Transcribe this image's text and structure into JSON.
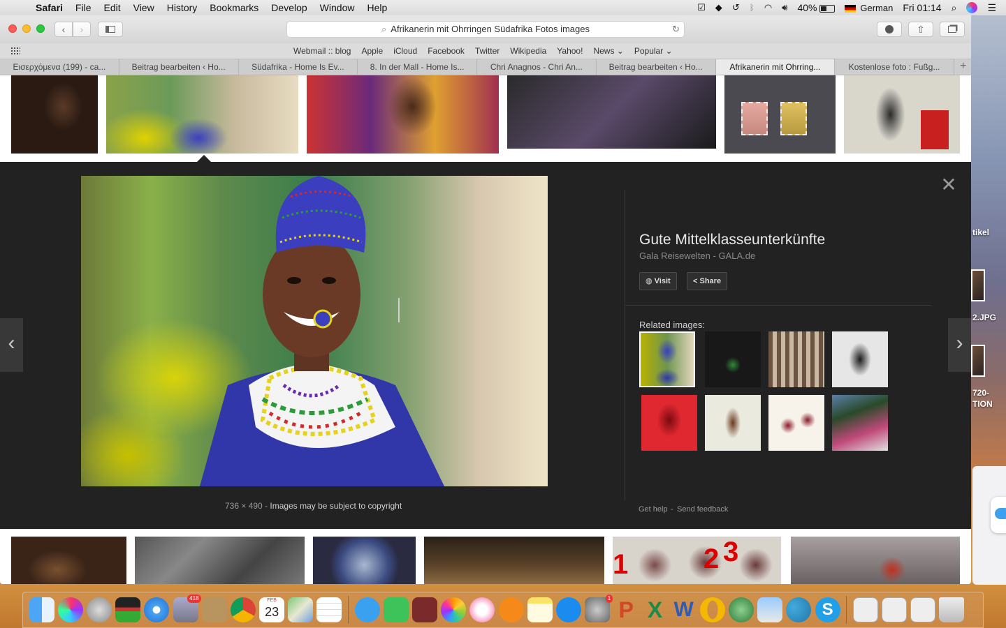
{
  "menubar": {
    "app": "Safari",
    "items": [
      "File",
      "Edit",
      "View",
      "History",
      "Bookmarks",
      "Develop",
      "Window",
      "Help"
    ],
    "battery": "40%",
    "language": "German",
    "clock": "Fri 01:14"
  },
  "toolbar": {
    "url": "Afrikanerin mit Ohrringen Südafrika Fotos images"
  },
  "favorites": [
    "Webmail :: blog",
    "Apple",
    "iCloud",
    "Facebook",
    "Twitter",
    "Wikipedia",
    "Yahoo!",
    "News ⌄",
    "Popular ⌄"
  ],
  "tabs": [
    {
      "label": "Εισερχόμενα (199) - ca..."
    },
    {
      "label": "Beitrag bearbeiten ‹ Ho..."
    },
    {
      "label": "Südafrika - Home Is Ev..."
    },
    {
      "label": "8. In der Mall - Home Is..."
    },
    {
      "label": "Chri Anagnos - Chri An..."
    },
    {
      "label": "Beitrag bearbeiten ‹ Ho..."
    },
    {
      "label": "Afrikanerin mit Ohrring..."
    },
    {
      "label": "Kostenlose foto : Fußg..."
    }
  ],
  "tab_plus": "+",
  "panel": {
    "title": "Gute Mittelklasseunterkünfte",
    "source": "Gala Reisewelten - GALA.de",
    "visit_label": "Visit",
    "share_label": "Share",
    "related_label": "Related images:",
    "dimensions": "736 × 490",
    "separator": "-",
    "copyright": "Images may be subject to copyright",
    "help": "Get help",
    "feedback": "Send feedback",
    "close_glyph": "✕",
    "prev_glyph": "‹",
    "next_glyph": "›"
  },
  "desktop": {
    "t1": "tikel",
    "t2": "2.JPG",
    "t3": "720-",
    "t4": "TION"
  },
  "dock": {
    "mail_badge": "418",
    "prefs_badge": "1",
    "calendar_month": "FEB",
    "calendar_day": "23"
  },
  "colors": {
    "panel_bg": "#222222",
    "accent_blue": "#3b3fbf"
  }
}
